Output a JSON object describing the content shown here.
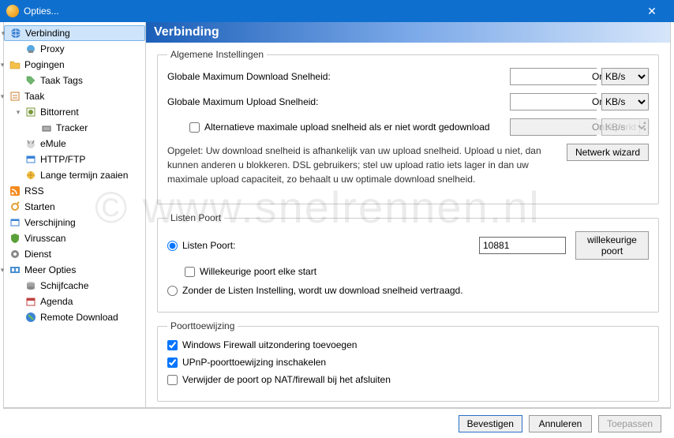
{
  "window": {
    "title": "Opties...",
    "close": "✕"
  },
  "sidebar": {
    "items": [
      {
        "label": "Verbinding"
      },
      {
        "label": "Proxy"
      },
      {
        "label": "Pogingen"
      },
      {
        "label": "Taak Tags"
      },
      {
        "label": "Taak"
      },
      {
        "label": "Bittorrent"
      },
      {
        "label": "Tracker"
      },
      {
        "label": "eMule"
      },
      {
        "label": "HTTP/FTP"
      },
      {
        "label": "Lange termijn zaaien"
      },
      {
        "label": "RSS"
      },
      {
        "label": "Starten"
      },
      {
        "label": "Verschijning"
      },
      {
        "label": "Virusscan"
      },
      {
        "label": "Dienst"
      },
      {
        "label": "Meer Opties"
      },
      {
        "label": "Schijfcache"
      },
      {
        "label": "Agenda"
      },
      {
        "label": "Remote Download"
      }
    ]
  },
  "panel": {
    "title": "Verbinding",
    "group1": {
      "legend": "Algemene Instellingen",
      "dl_label": "Globale Maximum Download Snelheid:",
      "dl_value": "Onbeperkt",
      "dl_unit": "KB/s",
      "ul_label": "Globale Maximum Upload Snelheid:",
      "ul_value": "Onbeperkt",
      "ul_unit": "KB/s",
      "alt_label": "Alternatieve maximale upload snelheid als er niet wordt gedownload",
      "alt_value": "Onbeperkt",
      "alt_unit": "KB/s",
      "note": "Opgelet: Uw download snelheid is afhankelijk van uw upload snelheid. Upload u niet, dan kunnen anderen u blokkeren. DSL gebruikers; stel uw upload ratio iets lager in dan uw maximale upload capaciteit, zo behaalt u uw optimale download snelheid.",
      "wizard_btn": "Netwerk wizard"
    },
    "group2": {
      "legend": "Listen Poort",
      "listen_label": "Listen Poort:",
      "port_value": "10881",
      "random_btn": "willekeurige poort",
      "random_start": "Willekeurige poort elke start",
      "without_label": "Zonder de Listen Instelling, wordt uw download snelheid vertraagd."
    },
    "group3": {
      "legend": "Poorttoewijzing",
      "fw": "Windows Firewall uitzondering toevoegen",
      "upnp": "UPnP-poorttoewijzing inschakelen",
      "remove": "Verwijder de poort op NAT/firewall bij het afsluiten"
    }
  },
  "footer": {
    "ok": "Bevestigen",
    "cancel": "Annuleren",
    "apply": "Toepassen"
  },
  "watermark": "www.snelrennen.nl"
}
